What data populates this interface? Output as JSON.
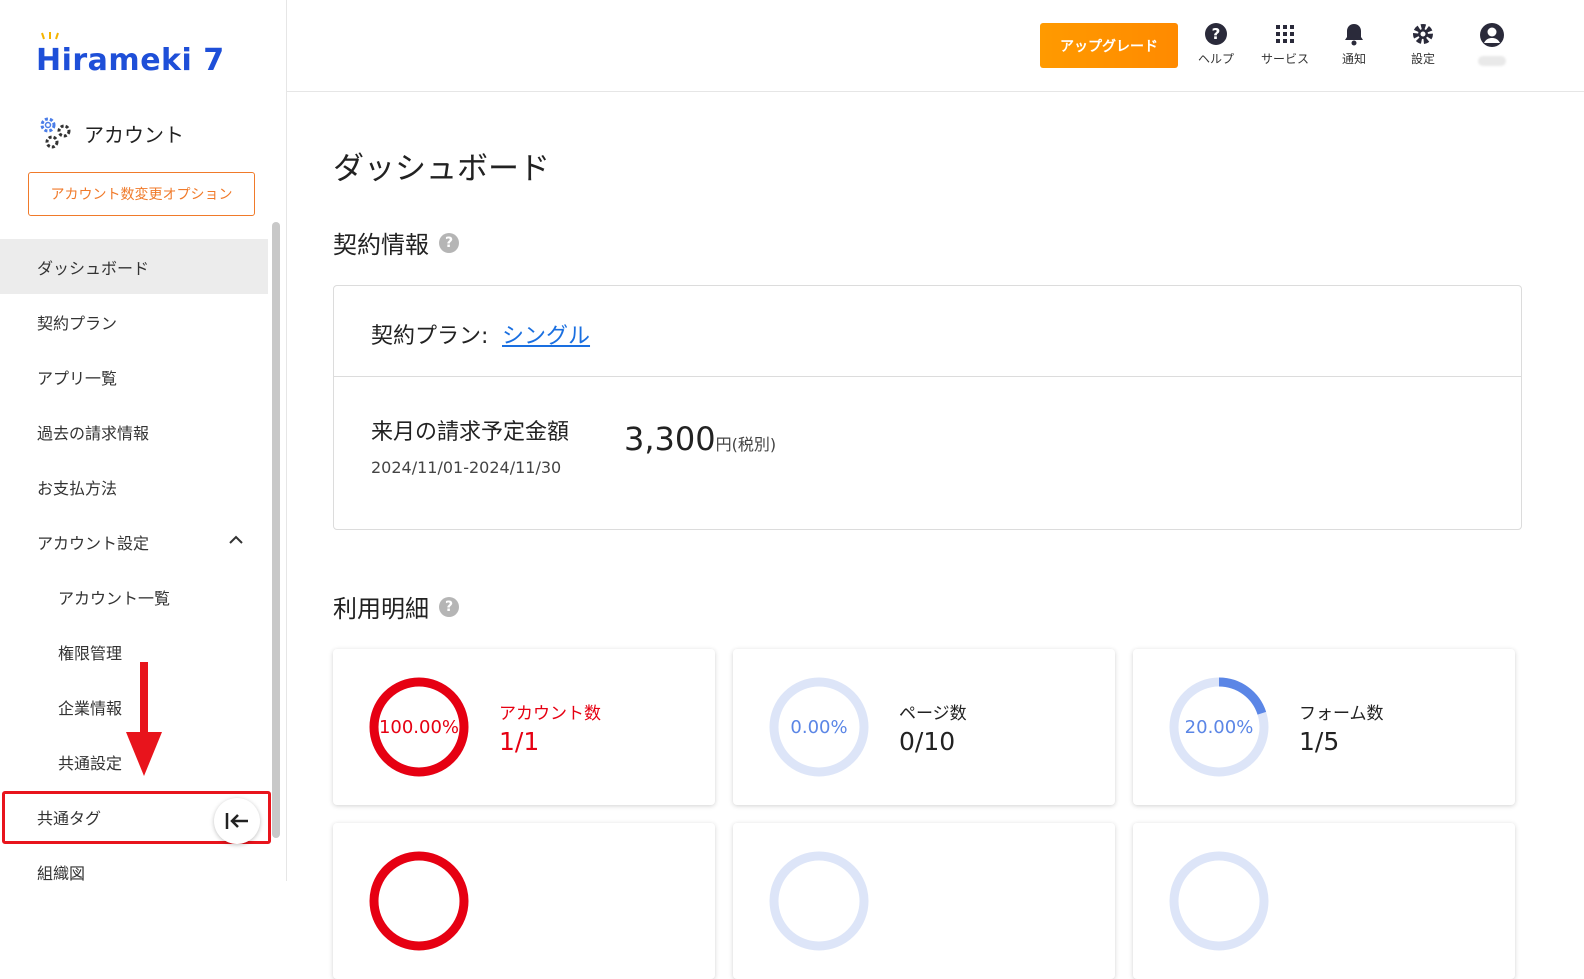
{
  "brand": {
    "logo_text": "Hirameki 7"
  },
  "sidebar": {
    "section_title": "アカウント",
    "option_button": "アカウント数変更オプション",
    "items": [
      {
        "label": "ダッシュボード"
      },
      {
        "label": "契約プラン"
      },
      {
        "label": "アプリ一覧"
      },
      {
        "label": "過去の請求情報"
      },
      {
        "label": "お支払方法"
      },
      {
        "label": "アカウント設定"
      },
      {
        "label": "アカウント一覧"
      },
      {
        "label": "権限管理"
      },
      {
        "label": "企業情報"
      },
      {
        "label": "共通設定"
      },
      {
        "label": "共通タグ"
      },
      {
        "label": "組織図"
      }
    ]
  },
  "header": {
    "upgrade_label": "アップグレード",
    "help_label": "ヘルプ",
    "services_label": "サービス",
    "notifications_label": "通知",
    "settings_label": "設定"
  },
  "main": {
    "page_title": "ダッシュボード",
    "contract_section_title": "契約情報",
    "contract_plan_label": "契約プラン:",
    "contract_plan_value": "シングル",
    "billing_label": "来月の請求予定金額",
    "billing_period": "2024/11/01-2024/11/30",
    "billing_amount": "3,300",
    "billing_unit": "円(税別)",
    "usage_section_title": "利用明細",
    "usage": [
      {
        "name": "アカウント数",
        "value": "1/1",
        "percent": "100.00%",
        "fraction": 1.0
      },
      {
        "name": "ページ数",
        "value": "0/10",
        "percent": "0.00%",
        "fraction": 0.0
      },
      {
        "name": "フォーム数",
        "value": "1/5",
        "percent": "20.00%",
        "fraction": 0.2
      }
    ]
  },
  "colors": {
    "brand_blue": "#1e4fd8",
    "accent_orange": "#ff9a00",
    "alert_red": "#e60012",
    "progress_blue": "#5b86e6",
    "track_light": "#dde5f8",
    "highlight_red": "#e8141c"
  }
}
